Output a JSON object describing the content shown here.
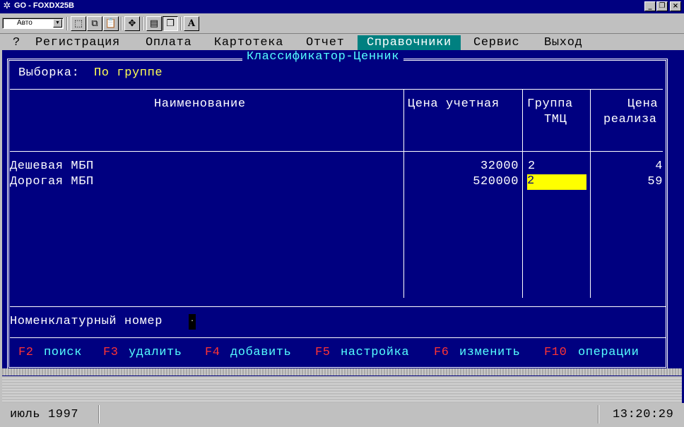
{
  "window": {
    "title": "GO - FOXDX25B",
    "icon": "gear-icon",
    "controls": [
      "_",
      "❐",
      "×"
    ]
  },
  "toolbar": {
    "font_select_value": "Авто",
    "buttons": [
      "select-icon",
      "copy-icon",
      "paste-icon",
      "fullscreen-icon",
      "properties-icon",
      "background-icon",
      "font-icon"
    ],
    "font_button_label": "A"
  },
  "menu": {
    "items": [
      "?",
      "Регистрация",
      "Оплата",
      "Картотека",
      "Отчет",
      "Справочники",
      "Сервис",
      "Выход"
    ],
    "active_index": 5
  },
  "form": {
    "title": "Классификатор-Ценник",
    "filter_label": "Выборка:",
    "filter_value": "По группе",
    "columns": {
      "name": "Наименование",
      "price": "Цена учетная",
      "group_line1": "Группа",
      "group_line2": "ТМЦ",
      "sale_line1": "Цена",
      "sale_line2": "реализа"
    },
    "rows": [
      {
        "name": "Дешевая МБП",
        "price": "32000",
        "group": "2",
        "sale": "4"
      },
      {
        "name": "Дорогая МБП",
        "price": "520000",
        "group": "2",
        "sale": "59"
      }
    ],
    "selected_row": 1,
    "nomenclature_label": "Номенклатурный номер"
  },
  "hotkeys": [
    {
      "key": "F2",
      "label": "поиск"
    },
    {
      "key": "F3",
      "label": "удалить"
    },
    {
      "key": "F4",
      "label": "добавить"
    },
    {
      "key": "F5",
      "label": "настройка"
    },
    {
      "key": "F6",
      "label": "изменить"
    },
    {
      "key": "F10",
      "label": "операции"
    }
  ],
  "status": {
    "date": "июль 1997",
    "time": "13:20:29"
  },
  "colors": {
    "screen_bg": "#000080",
    "menu_active": "#008080",
    "highlight": "#ffff00",
    "hotkey": "#ff3333",
    "title": "#55ffff"
  }
}
